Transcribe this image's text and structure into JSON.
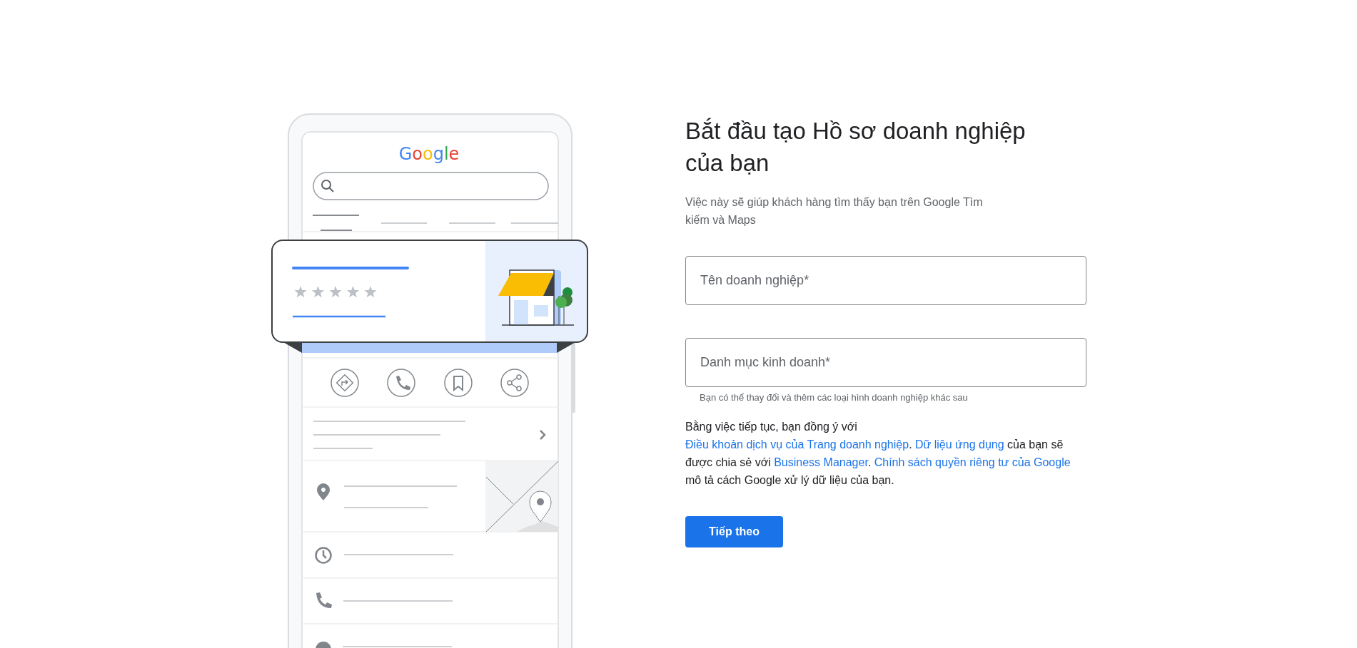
{
  "illustration": {
    "logo": "Google"
  },
  "heading": "Bắt đầu tạo Hồ sơ doanh nghiệp của bạn",
  "subtitle": "Việc này sẽ giúp khách hàng tìm thấy bạn trên Google Tìm kiếm và Maps",
  "fields": [
    {
      "placeholder": "Tên doanh nghiệp*"
    },
    {
      "placeholder": "Danh mục kinh doanh*",
      "hint": "Bạn có thể thay đổi và thêm các loại hình doanh nghiệp khác sau"
    }
  ],
  "consent": [
    {
      "kind": "text",
      "text": "Bằng việc tiếp tục, bạn đồng ý với "
    },
    {
      "kind": "link",
      "text": "Điều khoản dịch vụ của Trang doanh nghiệp"
    },
    {
      "kind": "text",
      "text": ". "
    },
    {
      "kind": "link",
      "text": "Dữ liệu ứng dụng"
    },
    {
      "kind": "text",
      "text": " của bạn sẽ được chia sẻ với "
    },
    {
      "kind": "link",
      "text": "Business Manager"
    },
    {
      "kind": "text",
      "text": ". "
    },
    {
      "kind": "link",
      "text": "Chính sách quyền riêng tư của Google"
    },
    {
      "kind": "text",
      "text": " mô tả cách Google xử lý dữ liệu của bạn."
    }
  ],
  "button": "Tiếp theo"
}
